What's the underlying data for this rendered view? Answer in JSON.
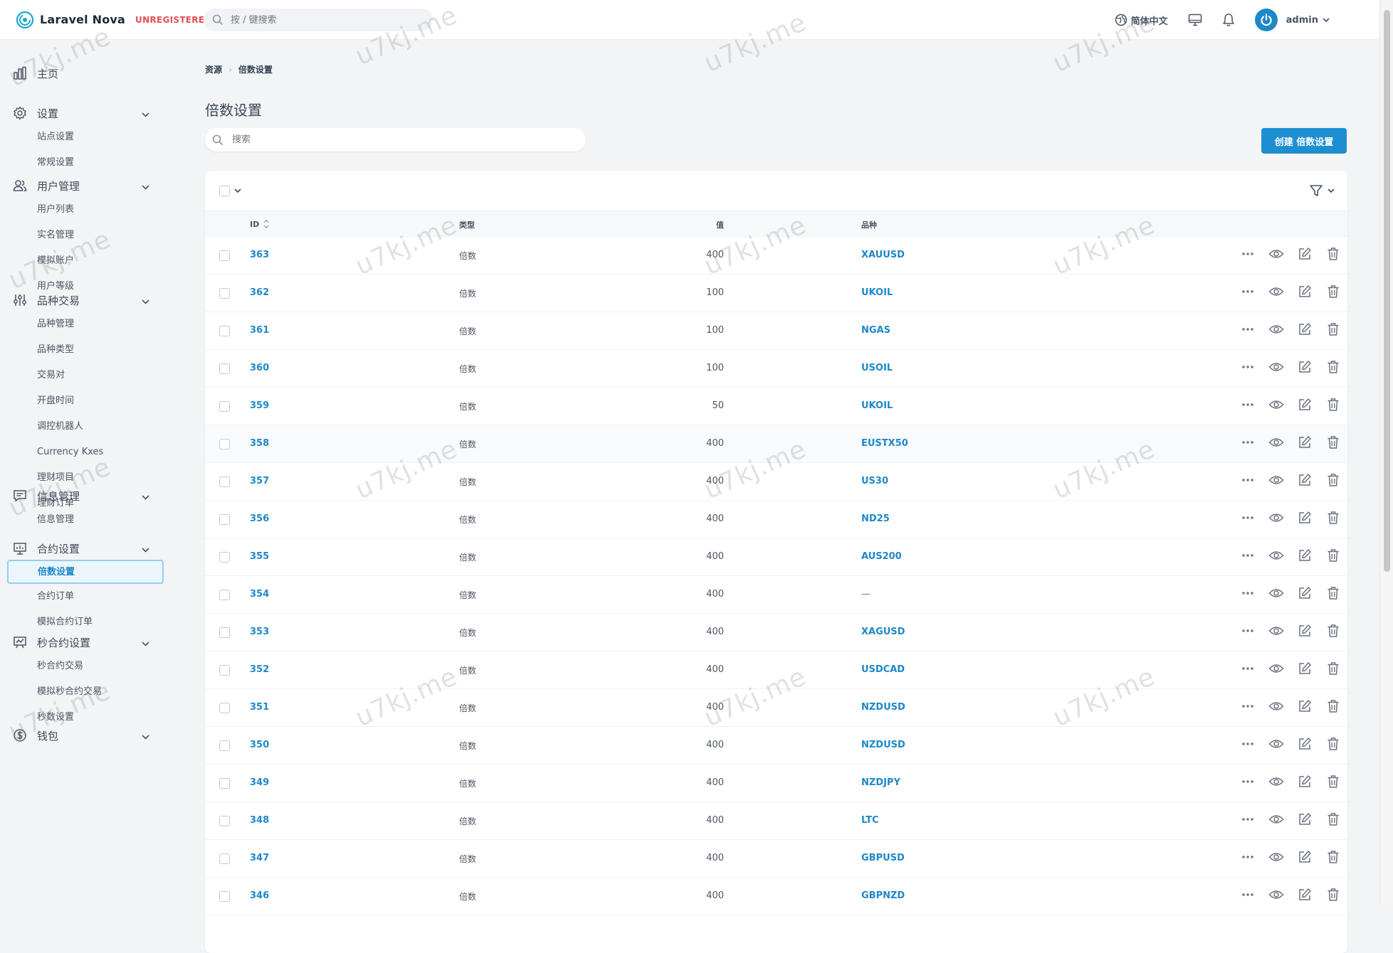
{
  "app": {
    "name": "Laravel Nova",
    "badge": "UNREGISTERED",
    "search_placeholder": "按 / 键搜索"
  },
  "topbar": {
    "language": "简体中文",
    "user": "admin"
  },
  "sidebar": {
    "home": "主页",
    "groups": [
      {
        "label": "设置",
        "icon": "gear-icon",
        "items": [
          "站点设置",
          "常规设置"
        ]
      },
      {
        "label": "用户管理",
        "icon": "users-icon",
        "items": [
          "用户列表",
          "实名管理",
          "模拟账户",
          "用户等级"
        ]
      },
      {
        "label": "品种交易",
        "icon": "sliders-icon",
        "items": [
          "品种管理",
          "品种类型",
          "交易对",
          "开盘时间",
          "调控机器人",
          "Currency Kxes",
          "理财项目",
          "理财订单"
        ]
      },
      {
        "label": "信息管理",
        "icon": "chat-icon",
        "items": [
          "信息管理"
        ]
      },
      {
        "label": "合约设置",
        "icon": "presentation-icon",
        "items": [
          "倍数设置",
          "合约订单",
          "模拟合约订单"
        ]
      },
      {
        "label": "秒合约设置",
        "icon": "chart-board-icon",
        "items": [
          "秒合约交易",
          "模拟秒合约交易",
          "秒数设置"
        ]
      },
      {
        "label": "钱包",
        "icon": "dollar-icon",
        "items": []
      }
    ],
    "active_item": "倍数设置"
  },
  "main": {
    "breadcrumb": [
      "资源",
      "倍数设置"
    ],
    "title": "倍数设置",
    "search_placeholder": "搜索",
    "create_button": "创建 倍数设置",
    "columns": {
      "id": "ID",
      "type": "类型",
      "value": "值",
      "variety": "品种"
    },
    "rows": [
      {
        "id": "363",
        "type": "倍数",
        "value": "400",
        "variety": "XAUUSD"
      },
      {
        "id": "362",
        "type": "倍数",
        "value": "100",
        "variety": "UKOIL"
      },
      {
        "id": "361",
        "type": "倍数",
        "value": "100",
        "variety": "NGAS"
      },
      {
        "id": "360",
        "type": "倍数",
        "value": "100",
        "variety": "USOIL"
      },
      {
        "id": "359",
        "type": "倍数",
        "value": "50",
        "variety": "UKOIL"
      },
      {
        "id": "358",
        "type": "倍数",
        "value": "400",
        "variety": "EUSTX50"
      },
      {
        "id": "357",
        "type": "倍数",
        "value": "400",
        "variety": "US30"
      },
      {
        "id": "356",
        "type": "倍数",
        "value": "400",
        "variety": "ND25"
      },
      {
        "id": "355",
        "type": "倍数",
        "value": "400",
        "variety": "AUS200"
      },
      {
        "id": "354",
        "type": "倍数",
        "value": "400",
        "variety": "—"
      },
      {
        "id": "353",
        "type": "倍数",
        "value": "400",
        "variety": "XAGUSD"
      },
      {
        "id": "352",
        "type": "倍数",
        "value": "400",
        "variety": "USDCAD"
      },
      {
        "id": "351",
        "type": "倍数",
        "value": "400",
        "variety": "NZDUSD"
      },
      {
        "id": "350",
        "type": "倍数",
        "value": "400",
        "variety": "NZDUSD"
      },
      {
        "id": "349",
        "type": "倍数",
        "value": "400",
        "variety": "NZDJPY"
      },
      {
        "id": "348",
        "type": "倍数",
        "value": "400",
        "variety": "LTC"
      },
      {
        "id": "347",
        "type": "倍数",
        "value": "400",
        "variety": "GBPUSD"
      },
      {
        "id": "346",
        "type": "倍数",
        "value": "400",
        "variety": "GBPNZD"
      }
    ]
  },
  "watermark": "u7kj.me",
  "colors": {
    "accent": "#1d8fd1",
    "link": "#1e88c8",
    "badge": "#e05252"
  }
}
